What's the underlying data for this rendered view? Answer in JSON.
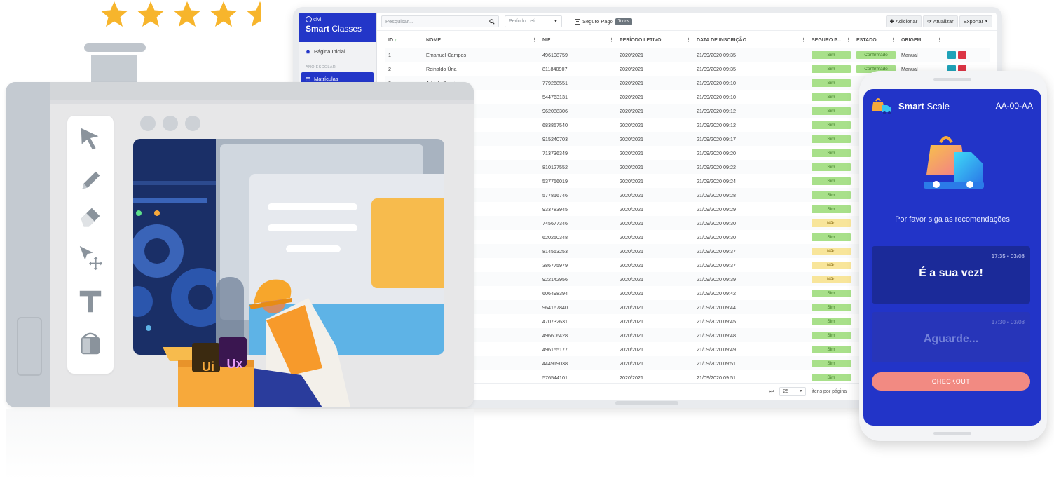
{
  "dashboard": {
    "brand_small": "civi",
    "brand_bold": "Smart",
    "brand_light": "Classes",
    "sidebar": {
      "home": "Página Inicial",
      "section": "ANO ESCOLAR",
      "active": "Matrículas"
    },
    "toolbar": {
      "search_placeholder": "Pesquisar...",
      "period_placeholder": "Período Leti...",
      "insurance_label": "Seguro Pago",
      "insurance_chip": "Todos",
      "add": "Adicionar",
      "refresh": "Atualizar",
      "export": "Exportar"
    },
    "columns": [
      "ID",
      "NOME",
      "NIF",
      "PERÍODO LETIVO",
      "DATA DE INSCRIÇÃO",
      "SEGURO P...",
      "ESTADO",
      "ORIGEM"
    ],
    "rows": [
      {
        "id": "1",
        "nome": "Emanuel Campos",
        "nif": "496108759",
        "periodo": "2020/2021",
        "data": "21/09/2020 09:35",
        "seguro": "Sim",
        "estado": "Confirmado",
        "origem": "Manual"
      },
      {
        "id": "2",
        "nome": "Reinaldo Úria",
        "nif": "811840907",
        "periodo": "2020/2021",
        "data": "21/09/2020 09:35",
        "seguro": "Sim",
        "estado": "Confirmado",
        "origem": "Manual"
      },
      {
        "id": "3",
        "nome": "Adriele Domingos",
        "nif": "779268551",
        "periodo": "2020/2021",
        "data": "21/09/2020 09:10",
        "seguro": "Sim",
        "estado": "",
        "origem": ""
      },
      {
        "id": "",
        "nome": "",
        "nif": "544763131",
        "periodo": "2020/2021",
        "data": "21/09/2020 09:10",
        "seguro": "Sim",
        "estado": "",
        "origem": ""
      },
      {
        "id": "",
        "nome": "",
        "nif": "962088306",
        "periodo": "2020/2021",
        "data": "21/09/2020 09:12",
        "seguro": "Sim",
        "estado": "",
        "origem": ""
      },
      {
        "id": "",
        "nome": "",
        "nif": "683857540",
        "periodo": "2020/2021",
        "data": "21/09/2020 09:12",
        "seguro": "Sim",
        "estado": "",
        "origem": ""
      },
      {
        "id": "",
        "nome": "",
        "nif": "915240703",
        "periodo": "2020/2021",
        "data": "21/09/2020 09:17",
        "seguro": "Sim",
        "estado": "",
        "origem": ""
      },
      {
        "id": "",
        "nome": "",
        "nif": "713736349",
        "periodo": "2020/2021",
        "data": "21/09/2020 09:20",
        "seguro": "Sim",
        "estado": "",
        "origem": ""
      },
      {
        "id": "",
        "nome": "",
        "nif": "810127552",
        "periodo": "2020/2021",
        "data": "21/09/2020 09:22",
        "seguro": "Sim",
        "estado": "",
        "origem": ""
      },
      {
        "id": "",
        "nome": "",
        "nif": "537756019",
        "periodo": "2020/2021",
        "data": "21/09/2020 09:24",
        "seguro": "Sim",
        "estado": "",
        "origem": ""
      },
      {
        "id": "",
        "nome": "",
        "nif": "577816746",
        "periodo": "2020/2021",
        "data": "21/09/2020 09:28",
        "seguro": "Sim",
        "estado": "",
        "origem": ""
      },
      {
        "id": "",
        "nome": "",
        "nif": "933783945",
        "periodo": "2020/2021",
        "data": "21/09/2020 09:29",
        "seguro": "Sim",
        "estado": "",
        "origem": ""
      },
      {
        "id": "",
        "nome": "",
        "nif": "745677346",
        "periodo": "2020/2021",
        "data": "21/09/2020 09:30",
        "seguro": "Não",
        "estado": "",
        "origem": ""
      },
      {
        "id": "",
        "nome": "",
        "nif": "620250348",
        "periodo": "2020/2021",
        "data": "21/09/2020 09:30",
        "seguro": "Sim",
        "estado": "",
        "origem": ""
      },
      {
        "id": "",
        "nome": "",
        "nif": "814553253",
        "periodo": "2020/2021",
        "data": "21/09/2020 09:37",
        "seguro": "Não",
        "estado": "",
        "origem": ""
      },
      {
        "id": "",
        "nome": "",
        "nif": "386775979",
        "periodo": "2020/2021",
        "data": "21/09/2020 09:37",
        "seguro": "Não",
        "estado": "",
        "origem": ""
      },
      {
        "id": "",
        "nome": "",
        "nif": "922142956",
        "periodo": "2020/2021",
        "data": "21/09/2020 09:39",
        "seguro": "Não",
        "estado": "",
        "origem": ""
      },
      {
        "id": "",
        "nome": "",
        "nif": "606498394",
        "periodo": "2020/2021",
        "data": "21/09/2020 09:42",
        "seguro": "Sim",
        "estado": "",
        "origem": ""
      },
      {
        "id": "",
        "nome": "",
        "nif": "964167840",
        "periodo": "2020/2021",
        "data": "21/09/2020 09:44",
        "seguro": "Sim",
        "estado": "",
        "origem": ""
      },
      {
        "id": "",
        "nome": "",
        "nif": "470732631",
        "periodo": "2020/2021",
        "data": "21/09/2020 09:45",
        "seguro": "Sim",
        "estado": "",
        "origem": ""
      },
      {
        "id": "",
        "nome": "",
        "nif": "496606428",
        "periodo": "2020/2021",
        "data": "21/09/2020 09:48",
        "seguro": "Sim",
        "estado": "",
        "origem": ""
      },
      {
        "id": "",
        "nome": "",
        "nif": "496155177",
        "periodo": "2020/2021",
        "data": "21/09/2020 09:49",
        "seguro": "Sim",
        "estado": "",
        "origem": ""
      },
      {
        "id": "",
        "nome": "",
        "nif": "444919038",
        "periodo": "2020/2021",
        "data": "21/09/2020 09:51",
        "seguro": "Sim",
        "estado": "",
        "origem": ""
      },
      {
        "id": "",
        "nome": "",
        "nif": "576544101",
        "periodo": "2020/2021",
        "data": "21/09/2020 09:51",
        "seguro": "Sim",
        "estado": "",
        "origem": ""
      }
    ],
    "pager": {
      "page_size": "25",
      "per_page_label": "itens por página"
    }
  },
  "editor": {
    "badge_ui": "Ui",
    "badge_ux": "Ux"
  },
  "phone": {
    "brand_bold": "Smart",
    "brand_light": "Scale",
    "code": "AA-00-AA",
    "message": "Por favor siga as recomendações",
    "card1": {
      "time": "17:35 • 03/08",
      "text": "É a sua vez!"
    },
    "card2": {
      "time": "17:30 • 03/08",
      "text": "Aguarde..."
    },
    "checkout": "CHECKOUT"
  },
  "colors": {
    "primary_blue": "#2336c8",
    "badge_yes": "#a8e08a",
    "badge_no": "#f8e59a",
    "checkout": "#f28a82",
    "star": "#f7b52c"
  },
  "rating": {
    "stars": 4.5,
    "max": 5
  }
}
